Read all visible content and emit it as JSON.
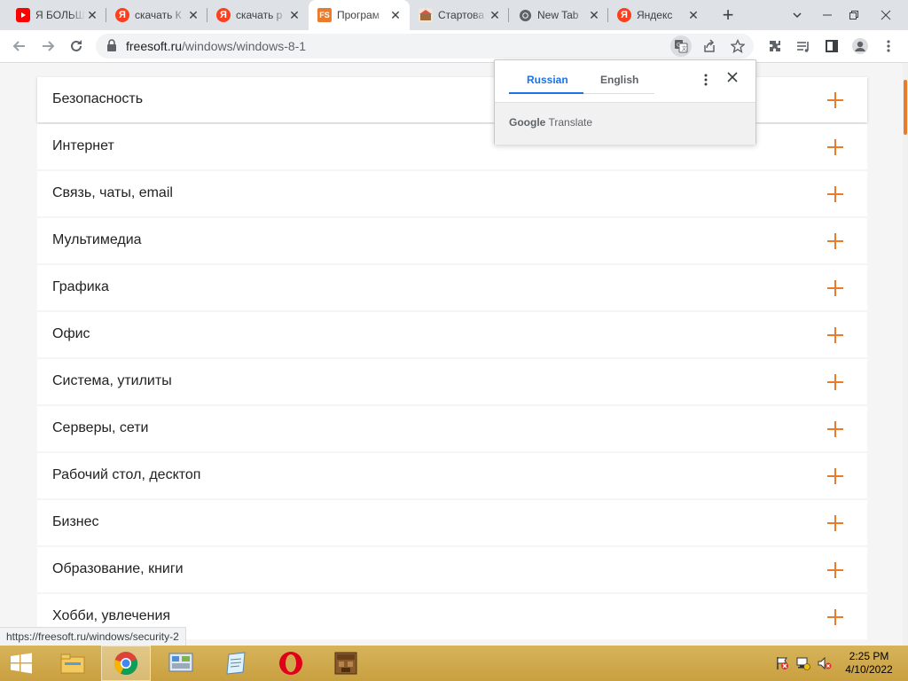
{
  "tabs": [
    {
      "title": "Я БОЛЬШ",
      "favicon": "youtube-icon",
      "color": "#ff0000"
    },
    {
      "title": "скачать К",
      "favicon": "yandex-icon",
      "color": "#fc3f1d"
    },
    {
      "title": "скачать р",
      "favicon": "yandex-icon",
      "color": "#fc3f1d"
    },
    {
      "title": "Програм",
      "favicon": "freesoft-icon",
      "color": "#e87c2c",
      "active": true
    },
    {
      "title": "Стартова",
      "favicon": "start-page-icon",
      "color": "#9c6b3f"
    },
    {
      "title": "New Tab",
      "favicon": "chrome-icon",
      "color": "#5f6368"
    },
    {
      "title": "Яндекс",
      "favicon": "yandex-icon",
      "color": "#fc3f1d"
    }
  ],
  "address": {
    "domain": "freesoft.ru",
    "path": "/windows/windows-8-1"
  },
  "translate": {
    "lang_source": "Russian",
    "lang_target": "English",
    "brand_google": "Google",
    "brand_translate": "Translate"
  },
  "categories": [
    "Безопасность",
    "Интернет",
    "Связь, чаты, email",
    "Мультимедиа",
    "Графика",
    "Офис",
    "Система, утилиты",
    "Серверы, сети",
    "Рабочий стол, десктоп",
    "Бизнес",
    "Образование, книги",
    "Хобби, увлечения"
  ],
  "status_link": "https://freesoft.ru/windows/security-2",
  "taskbar": {
    "time": "2:25 PM",
    "date": "4/10/2022"
  },
  "colors": {
    "accent": "#e87c2c",
    "translate_blue": "#1a73e8",
    "taskbar": "#d1aa4d"
  }
}
